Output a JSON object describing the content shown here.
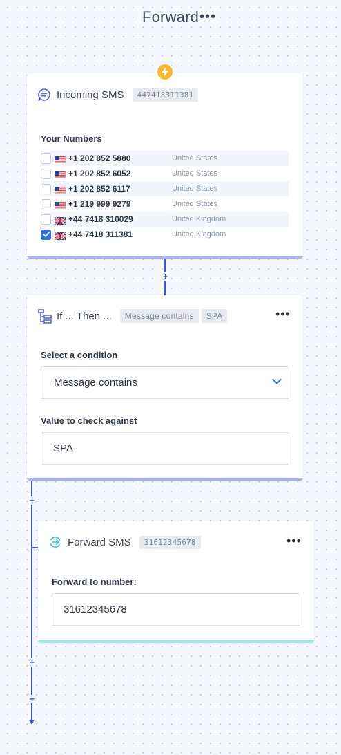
{
  "header": {
    "title": "Forward",
    "more": "•••"
  },
  "incoming": {
    "title": "Incoming SMS",
    "tag": "447418311381",
    "numbers_label": "Your Numbers",
    "numbers": [
      {
        "phone": "+1 202 852 5880",
        "country": "United States",
        "flag": "us",
        "checked": false
      },
      {
        "phone": "+1 202 852 6052",
        "country": "United States",
        "flag": "us",
        "checked": false
      },
      {
        "phone": "+1 202 852 6117",
        "country": "United States",
        "flag": "us",
        "checked": false
      },
      {
        "phone": "+1 219 999 9279",
        "country": "United States",
        "flag": "us",
        "checked": false
      },
      {
        "phone": "+44 7418 310029",
        "country": "United Kingdom",
        "flag": "uk",
        "checked": false
      },
      {
        "phone": "+44 7418 311381",
        "country": "United Kingdom",
        "flag": "uk",
        "checked": true
      }
    ]
  },
  "condition": {
    "title": "If ... Then ...",
    "tags": [
      "Message contains",
      "SPA"
    ],
    "more": "•••",
    "select_label": "Select a condition",
    "select_value": "Message contains",
    "value_label": "Value to check against",
    "value": "SPA"
  },
  "forward": {
    "title": "Forward SMS",
    "tag": "31612345678",
    "more": "•••",
    "field_label": "Forward to number:",
    "value": "31612345678"
  },
  "connectors": {
    "plus": "+"
  },
  "colors": {
    "accent": "#3f51e0",
    "incoming_bar": "#a9b4ee",
    "condition_bar": "#a9b4ee",
    "forward_bar": "#9de9e3",
    "trigger_badge": "#f5b82e",
    "forward_icon": "#2bc7c0",
    "checkbox_checked": "#2f6fe0"
  }
}
